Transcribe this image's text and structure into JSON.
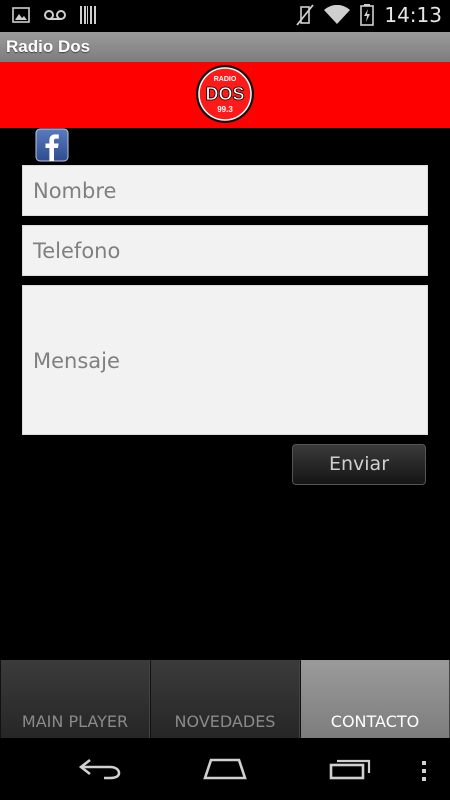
{
  "status_bar": {
    "time": "14:13",
    "icons": [
      "image-icon",
      "voicemail-icon",
      "barcode-icon",
      "vibrate-off-icon",
      "wifi-icon",
      "battery-charging-icon",
      "signal-icon"
    ]
  },
  "app": {
    "title": "Radio Dos",
    "logo": {
      "top_text": "RADIO",
      "main_text": "DOS",
      "freq_text": "99.3"
    }
  },
  "colors": {
    "banner": "#ff0000",
    "title_bar": "#8a8a8a",
    "background": "#000000"
  },
  "form": {
    "nombre_placeholder": "Nombre",
    "telefono_placeholder": "Telefono",
    "mensaje_placeholder": "Mensaje",
    "submit_label": "Enviar"
  },
  "tabs": [
    {
      "label": "MAIN PLAYER",
      "active": false
    },
    {
      "label": "NOVEDADES",
      "active": false
    },
    {
      "label": "CONTACTO",
      "active": true
    }
  ]
}
